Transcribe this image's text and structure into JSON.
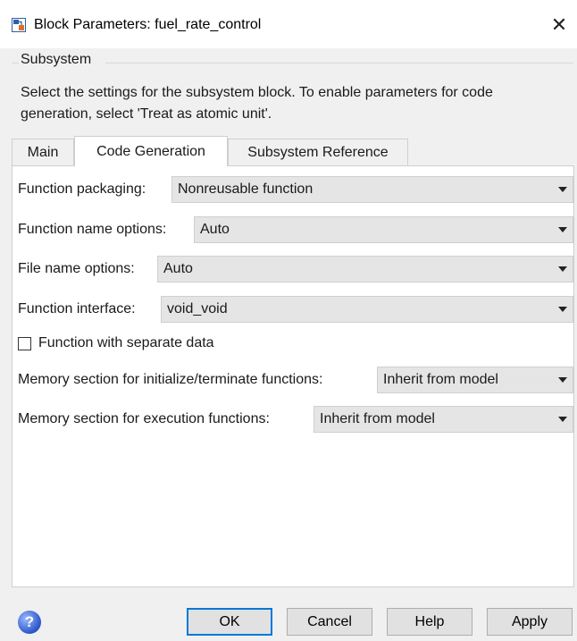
{
  "window": {
    "title": "Block Parameters: fuel_rate_control",
    "close_glyph": "✕"
  },
  "group": {
    "label": "Subsystem",
    "description": "Select the settings for the subsystem block. To enable parameters for code generation, select 'Treat as atomic unit'."
  },
  "tabs": [
    {
      "label": "Main",
      "active": false
    },
    {
      "label": "Code Generation",
      "active": true
    },
    {
      "label": "Subsystem Reference",
      "active": false
    }
  ],
  "params": {
    "function_packaging": {
      "label": "Function packaging:",
      "value": "Nonreusable function"
    },
    "function_name_options": {
      "label": "Function name options:",
      "value": "Auto"
    },
    "file_name_options": {
      "label": "File name options:",
      "value": "Auto"
    },
    "function_interface": {
      "label": "Function interface:",
      "value": "void_void"
    },
    "separate_data": {
      "label": "Function with separate data",
      "checked": false
    },
    "memory_init_term": {
      "label": "Memory section for initialize/terminate functions:",
      "value": "Inherit from model"
    },
    "memory_execution": {
      "label": "Memory section for execution functions:",
      "value": "Inherit from model"
    }
  },
  "footer": {
    "help_icon_glyph": "?",
    "ok_label": "OK",
    "cancel_label": "Cancel",
    "help_label": "Help",
    "apply_label": "Apply"
  },
  "colors": {
    "accent": "#0078d7",
    "dropdown_bg": "#e5e5e5",
    "dialog_bg": "#f0f0f0"
  }
}
